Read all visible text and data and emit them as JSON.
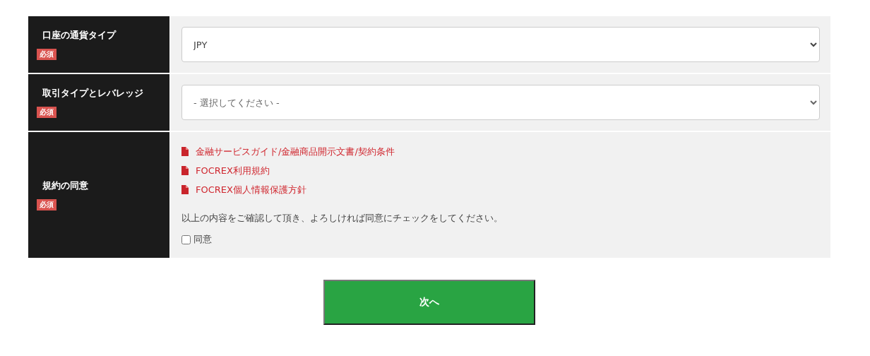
{
  "rows": [
    {
      "kind": "select",
      "label": "口座の通貨タイプ",
      "badge": "必須",
      "value": "JPY",
      "placeholder_shown": false
    },
    {
      "kind": "select",
      "label": "取引タイプとレバレッジ",
      "badge": "必須",
      "value": "- 選択してください -",
      "placeholder_shown": true
    },
    {
      "kind": "agreement",
      "label": "規約の同意",
      "badge": "必須",
      "links": [
        "金融サービスガイド/金融商品開示文書/契約条件",
        "FOCREX利用規約",
        "FOCREX個人情報保護方針"
      ],
      "note": "以上の内容をご確認して頂き、よろしければ同意にチェックをしてください。",
      "checkbox": {
        "label": "同意",
        "checked": false
      }
    }
  ],
  "next_button": "次へ"
}
